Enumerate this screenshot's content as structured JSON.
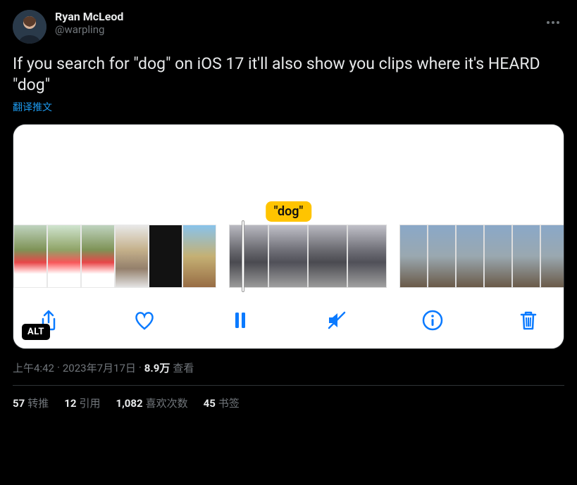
{
  "author": {
    "display_name": "Ryan McLeod",
    "handle": "@warpling"
  },
  "body_text": "If you search for \"dog\" on iOS 17 it'll also show you clips where it's HEARD \"dog\"",
  "translate_label": "翻译推文",
  "caption_tag": "\"dog\"",
  "alt_badge": "ALT",
  "meta": {
    "time": "上午4:42",
    "dot1": " · ",
    "date": "2023年7月17日",
    "dot2": " · ",
    "views_num": "8.9万",
    "views_label": " 查看"
  },
  "stats": {
    "retweets_num": "57",
    "retweets_label": "转推",
    "quotes_num": "12",
    "quotes_label": "引用",
    "likes_num": "1,082",
    "likes_label": "喜欢次数",
    "bookmarks_num": "45",
    "bookmarks_label": "书签"
  }
}
